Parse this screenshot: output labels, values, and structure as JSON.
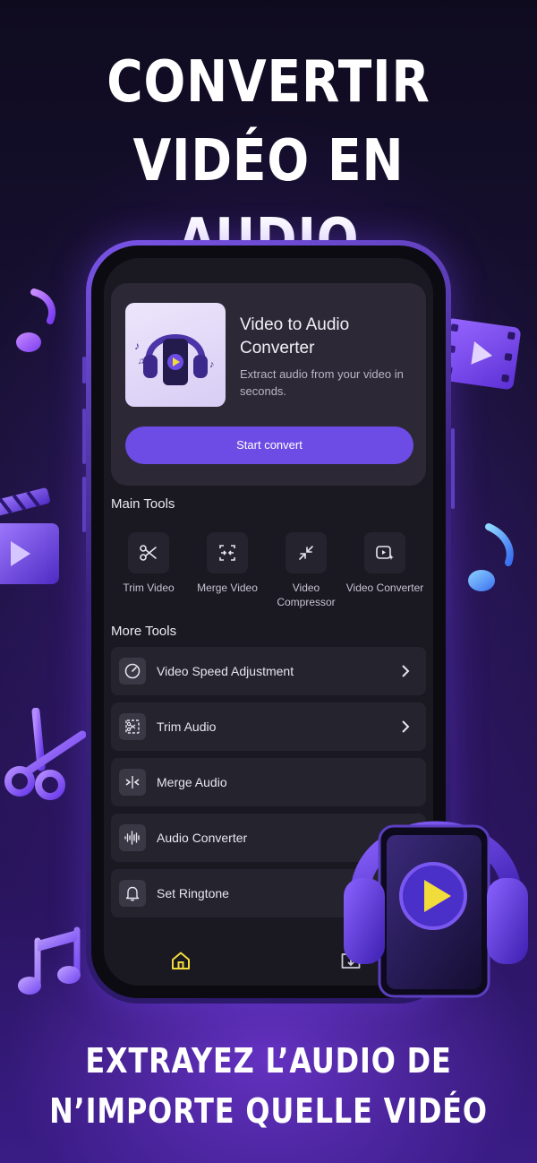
{
  "headline_top": [
    "CONVERTIR",
    "VIDÉO EN AUDIO"
  ],
  "headline_bottom": [
    "EXTRAYEZ L’AUDIO DE",
    "N’IMPORTE QUELLE VIDÉO"
  ],
  "hero": {
    "title": "Video to Audio Converter",
    "subtitle": "Extract audio from your video in seconds.",
    "button": "Start convert"
  },
  "main_tools": {
    "title": "Main Tools",
    "items": [
      {
        "label": "Trim Video",
        "icon": "scissors-icon"
      },
      {
        "label": "Merge Video",
        "icon": "merge-icon"
      },
      {
        "label": "Video Compressor",
        "icon": "compress-icon"
      },
      {
        "label": "Video Converter",
        "icon": "video-convert-icon"
      }
    ]
  },
  "more_tools": {
    "title": "More Tools",
    "items": [
      {
        "label": "Video Speed Adjustment",
        "icon": "speedometer-icon"
      },
      {
        "label": "Trim Audio",
        "icon": "trim-audio-icon"
      },
      {
        "label": "Merge Audio",
        "icon": "merge-audio-icon"
      },
      {
        "label": "Audio Converter",
        "icon": "waveform-icon"
      },
      {
        "label": "Set Ringtone",
        "icon": "bell-icon"
      }
    ]
  },
  "nav": [
    {
      "name": "home",
      "icon": "home-icon",
      "active": true
    },
    {
      "name": "downloads",
      "icon": "download-folder-icon",
      "active": false
    }
  ],
  "colors": {
    "accent": "#6d4ce6",
    "nav_active": "#f2dc3c",
    "card": "#2c2836",
    "screen": "#1a1821"
  }
}
